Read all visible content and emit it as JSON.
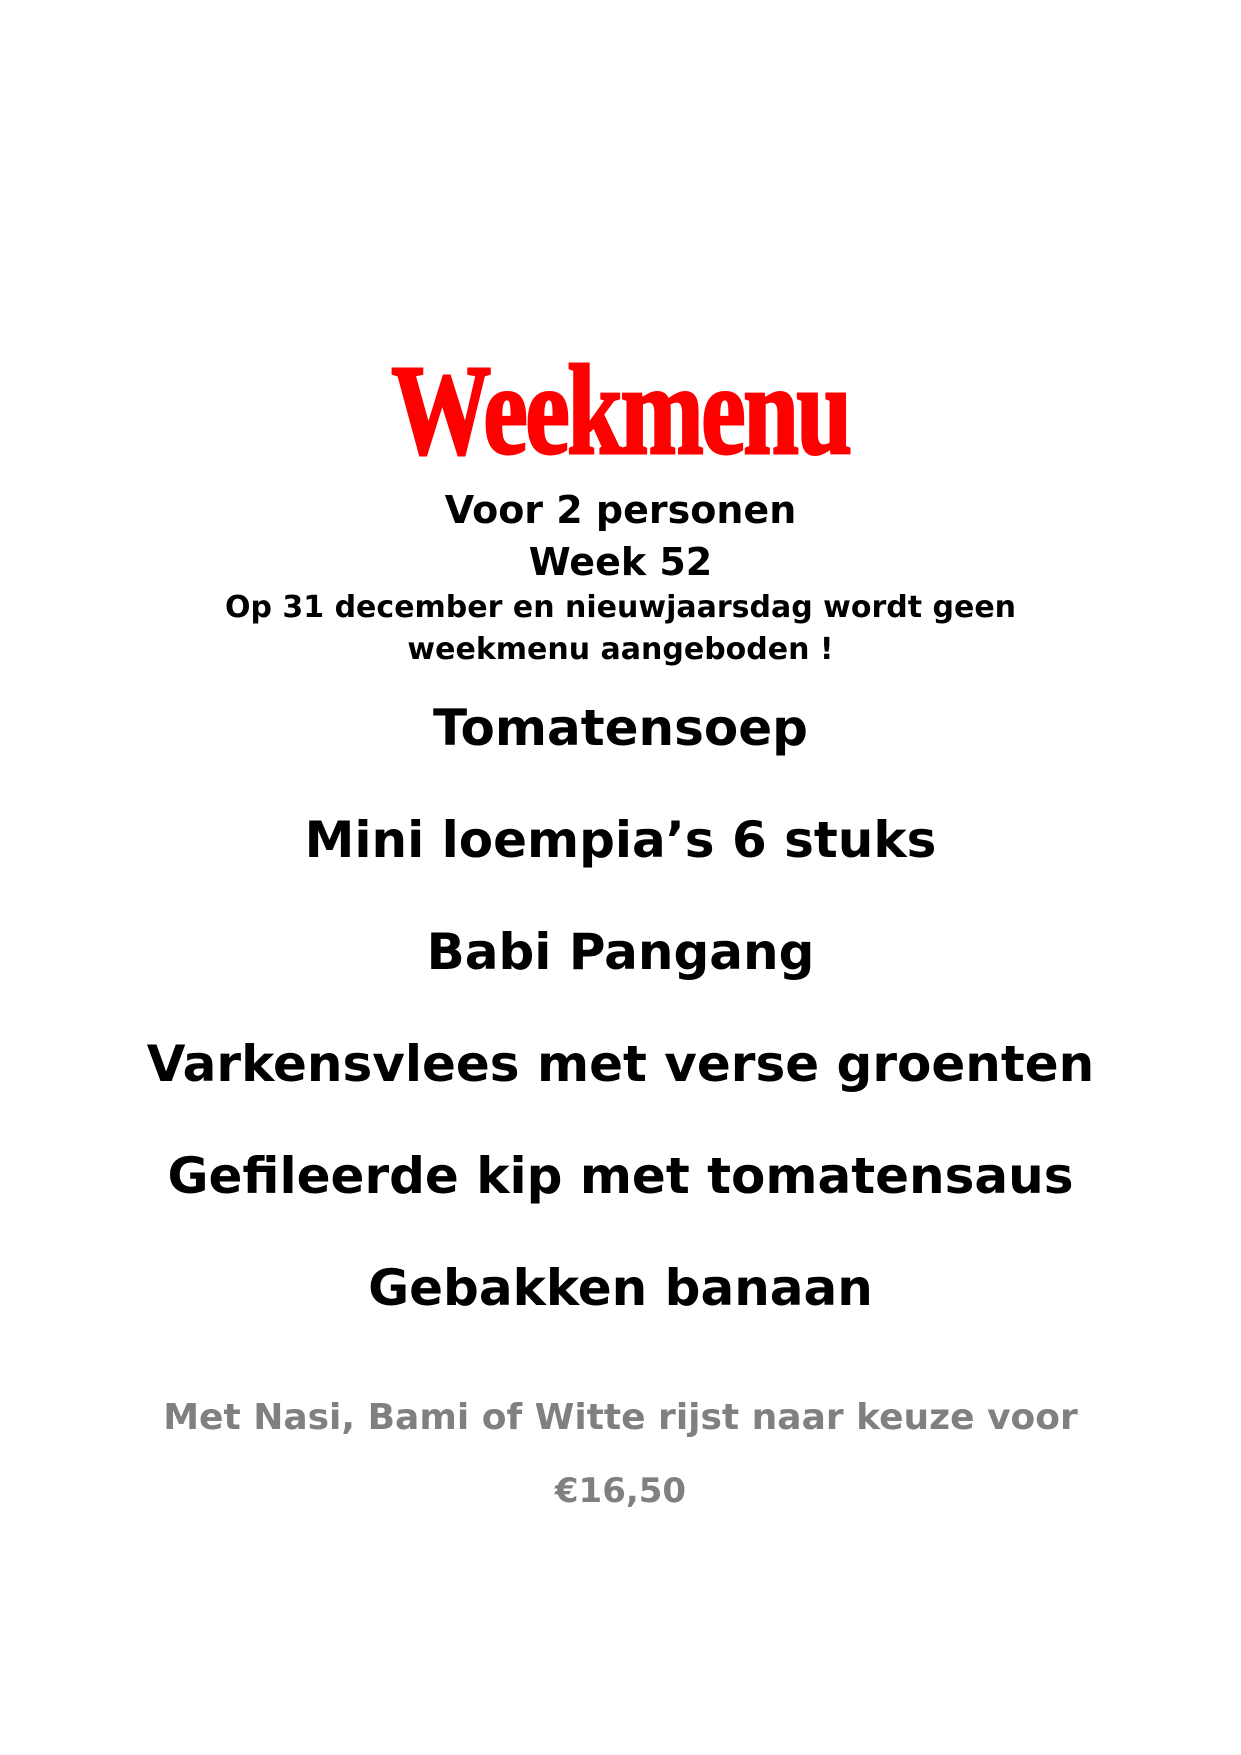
{
  "colors": {
    "title": "#ff0000",
    "text": "#000000",
    "footer": "#808080"
  },
  "menu": {
    "title": "Weekmenu",
    "subtitle": "Voor 2 personen",
    "week": "Week 52",
    "notice_line1": "Op 31 december en nieuwjaarsdag wordt geen",
    "notice_line2": "weekmenu aangeboden !",
    "dishes": [
      "Tomatensoep",
      "Mini loempia’s 6 stuks",
      "Babi Pangang",
      "Varkensvlees met verse groenten",
      "Gefileerde kip met tomatensaus",
      "Gebakken banaan"
    ],
    "footer_text": "Met Nasi, Bami of Witte rijst naar keuze voor",
    "price": "€16,50"
  }
}
